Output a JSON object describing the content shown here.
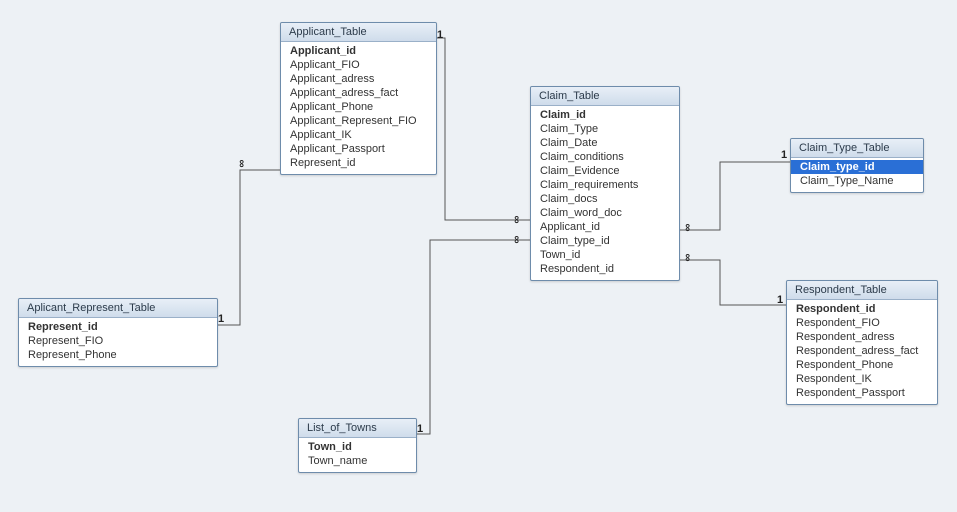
{
  "entities": {
    "applicant": {
      "title": "Applicant_Table",
      "fields": [
        {
          "name": "Applicant_id",
          "pk": true
        },
        {
          "name": "Applicant_FIO"
        },
        {
          "name": "Applicant_adress"
        },
        {
          "name": "Applicant_adress_fact"
        },
        {
          "name": "Applicant_Phone"
        },
        {
          "name": "Applicant_Represent_FIO"
        },
        {
          "name": "Applicant_IK"
        },
        {
          "name": "Applicant_Passport"
        },
        {
          "name": "Represent_id"
        }
      ]
    },
    "represent": {
      "title": "Aplicant_Represent_Table",
      "fields": [
        {
          "name": "Represent_id",
          "pk": true
        },
        {
          "name": "Represent_FIO"
        },
        {
          "name": "Represent_Phone"
        }
      ]
    },
    "claim": {
      "title": "Claim_Table",
      "fields": [
        {
          "name": "Claim_id",
          "pk": true
        },
        {
          "name": "Claim_Type"
        },
        {
          "name": "Claim_Date"
        },
        {
          "name": "Claim_conditions"
        },
        {
          "name": "Claim_Evidence"
        },
        {
          "name": "Claim_requirements"
        },
        {
          "name": "Claim_docs"
        },
        {
          "name": "Claim_word_doc"
        },
        {
          "name": "Applicant_id"
        },
        {
          "name": "Claim_type_id"
        },
        {
          "name": "Town_id"
        },
        {
          "name": "Respondent_id"
        }
      ]
    },
    "claimtype": {
      "title": "Claim_Type_Table",
      "fields": [
        {
          "name": "Claim_type_id",
          "pk": true,
          "selected": true
        },
        {
          "name": "Claim_Type_Name"
        }
      ]
    },
    "respondent": {
      "title": "Respondent_Table",
      "fields": [
        {
          "name": "Respondent_id",
          "pk": true
        },
        {
          "name": "Respondent_FIO"
        },
        {
          "name": "Respondent_adress"
        },
        {
          "name": "Respondent_adress_fact"
        },
        {
          "name": "Respondent_Phone"
        },
        {
          "name": "Respondent_IK"
        },
        {
          "name": "Respondent_Passport"
        }
      ]
    },
    "towns": {
      "title": "List_of_Towns",
      "fields": [
        {
          "name": "Town_id",
          "pk": true
        },
        {
          "name": "Town_name"
        }
      ]
    }
  },
  "relationships": [
    {
      "from": "represent",
      "to": "applicant",
      "from_card": "1",
      "to_card": "∞"
    },
    {
      "from": "applicant",
      "to": "claim",
      "from_card": "1",
      "to_card": "∞"
    },
    {
      "from": "towns",
      "to": "claim",
      "from_card": "1",
      "to_card": "∞"
    },
    {
      "from": "claimtype",
      "to": "claim",
      "from_card": "1",
      "to_card": "∞"
    },
    {
      "from": "respondent",
      "to": "claim",
      "from_card": "1",
      "to_card": "∞"
    }
  ],
  "cardinality_labels": {
    "one": "1",
    "many": "∞"
  }
}
